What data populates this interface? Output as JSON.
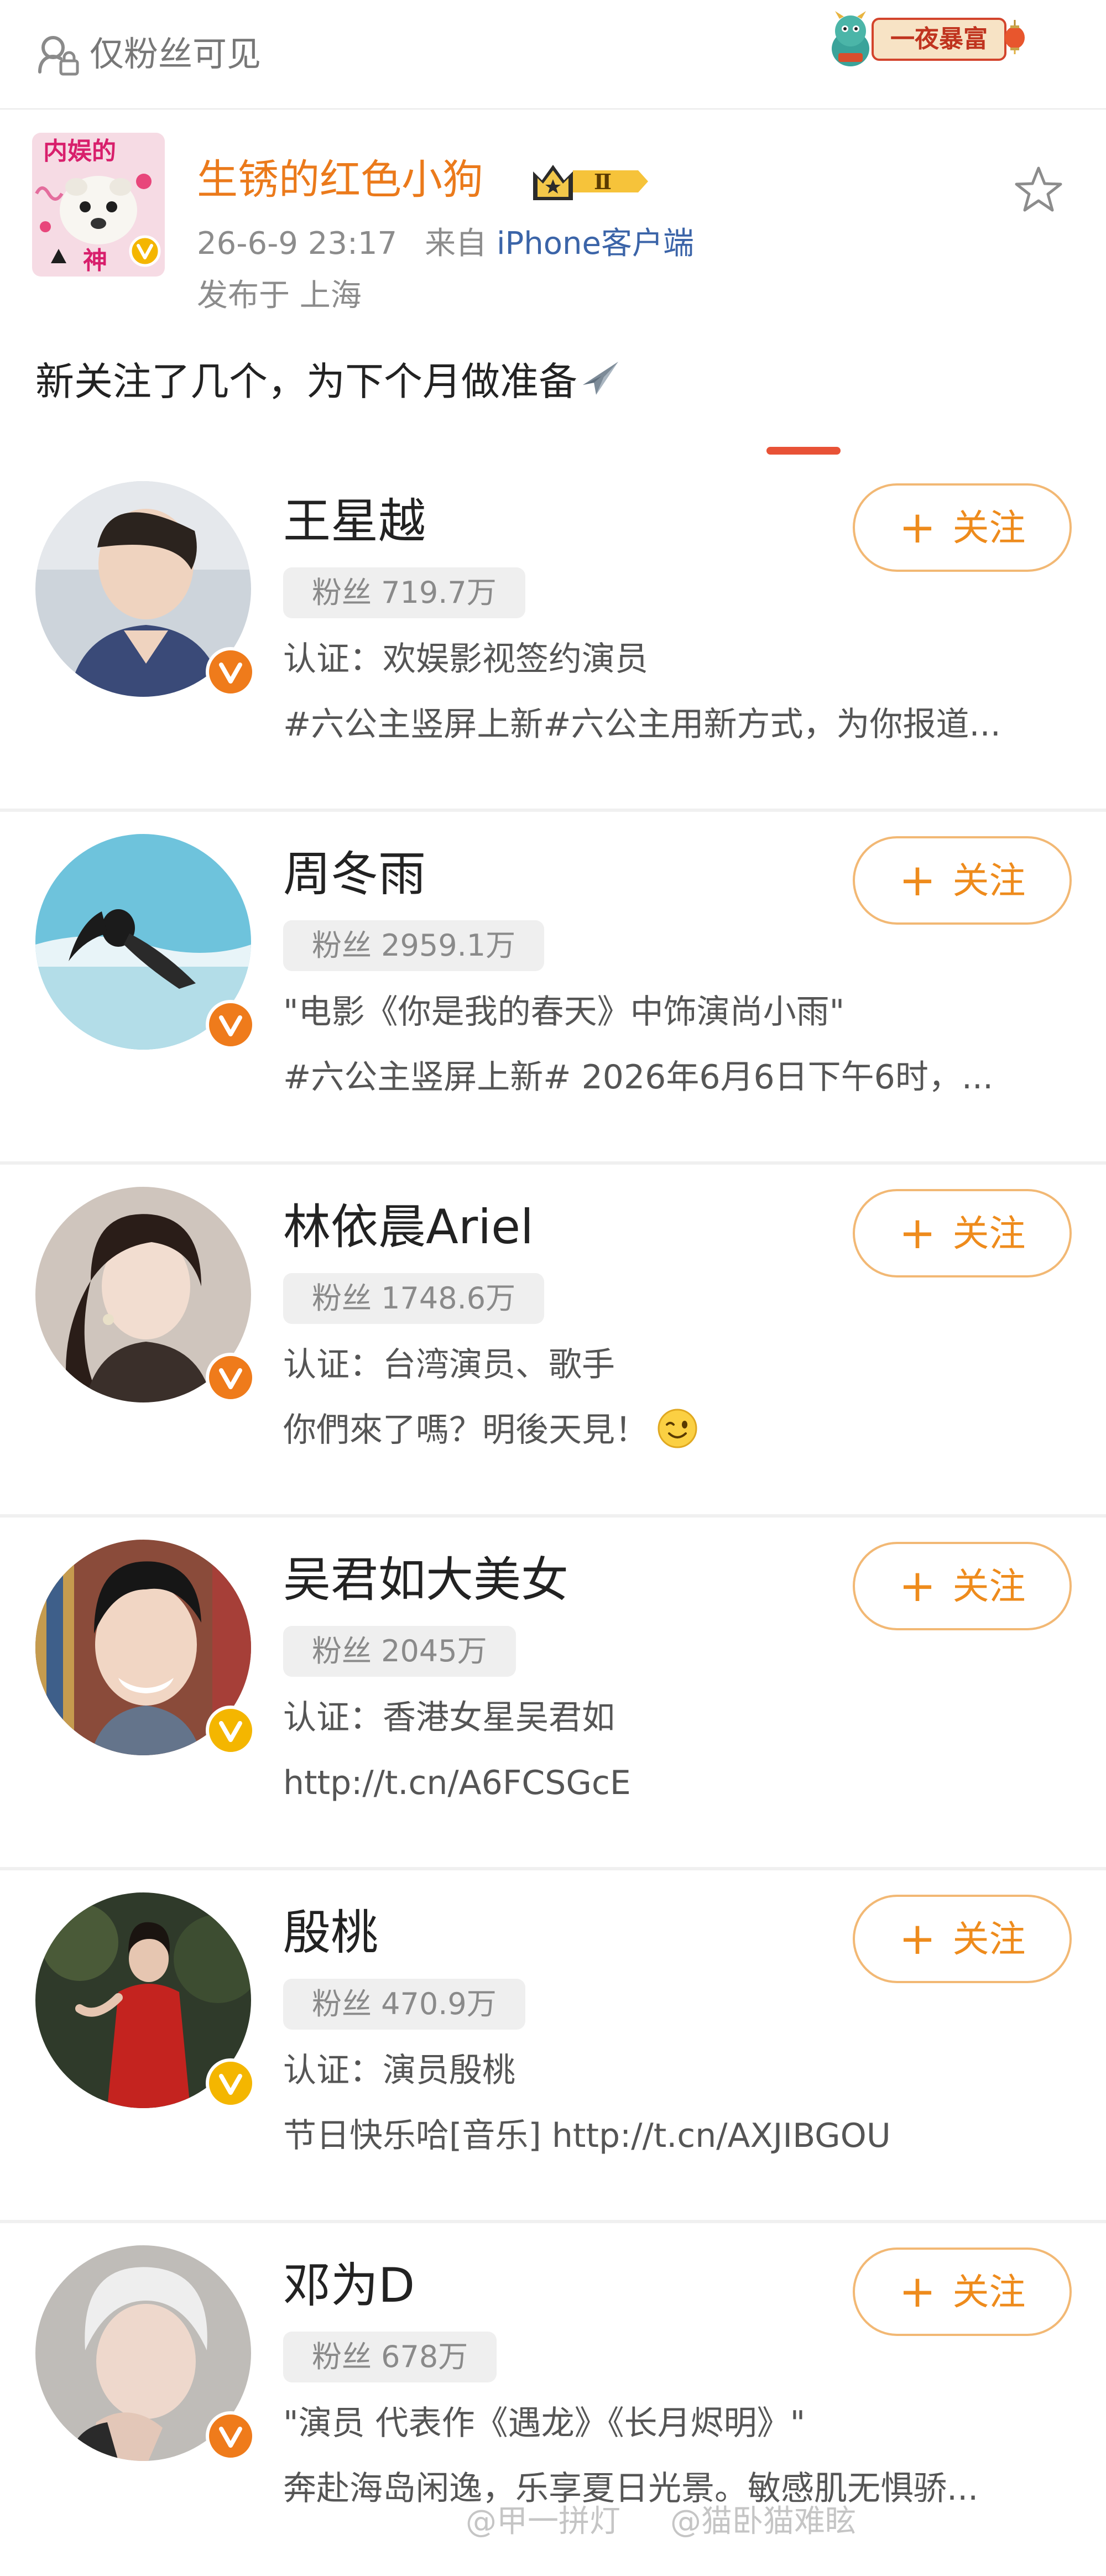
{
  "privacy": {
    "label": "仅粉丝可见",
    "icon": "lock-group-icon"
  },
  "banner": {
    "text": "一夜暴富"
  },
  "post": {
    "author": "生锈的红色小狗",
    "level_badge": "Ⅱ",
    "time": "26-6-9 23:17",
    "source_prefix": "来自",
    "source_client": "iPhone客户端",
    "location": "发布于 上海",
    "text": "新关注了几个，为下个月做准备",
    "avatar_caption_top": "内娱的",
    "avatar_caption_bottom": "神"
  },
  "follow_label": "关注",
  "users": [
    {
      "name": "王星越",
      "fans": "粉丝 719.7万",
      "desc": "认证：欢娱影视签约演员",
      "intro": "#六公主竖屏上新#六公主用新方式，为你报道...",
      "badge_color": "#ef7b1b"
    },
    {
      "name": "周冬雨",
      "fans": "粉丝 2959.1万",
      "desc": "\"电影《你是我的春天》中饰演尚小雨\"",
      "intro": "#六公主竖屏上新# 2026年6月6日下午6时，...",
      "badge_color": "#ef7b1b"
    },
    {
      "name": "林依晨Ariel",
      "fans": "粉丝 1748.6万",
      "desc": "认证：台湾演员、歌手",
      "intro": "你們來了嗎？明後天見！",
      "badge_color": "#ef7b1b"
    },
    {
      "name": "吴君如大美女",
      "fans": "粉丝 2045万",
      "desc": "认证：香港女星吴君如",
      "intro": "http://t.cn/A6FCSGcE",
      "badge_color": "#f4b600"
    },
    {
      "name": "殷桃",
      "fans": "粉丝 470.9万",
      "desc": "认证：演员殷桃",
      "intro": "节日快乐哈[音乐] http://t.cn/AXJIBGOU",
      "badge_color": "#f4b600"
    },
    {
      "name": "邓为D",
      "fans": "粉丝 678万",
      "desc": "\"演员 代表作《遇龙》《长月烬明》\"",
      "intro": "奔赴海岛闲逸，乐享夏日光景。敏感肌无惧骄...",
      "badge_color": "#ef7b1b"
    }
  ],
  "watermark": {
    "left": "@甲一拼灯",
    "right": "@猫卧猫难眩"
  }
}
